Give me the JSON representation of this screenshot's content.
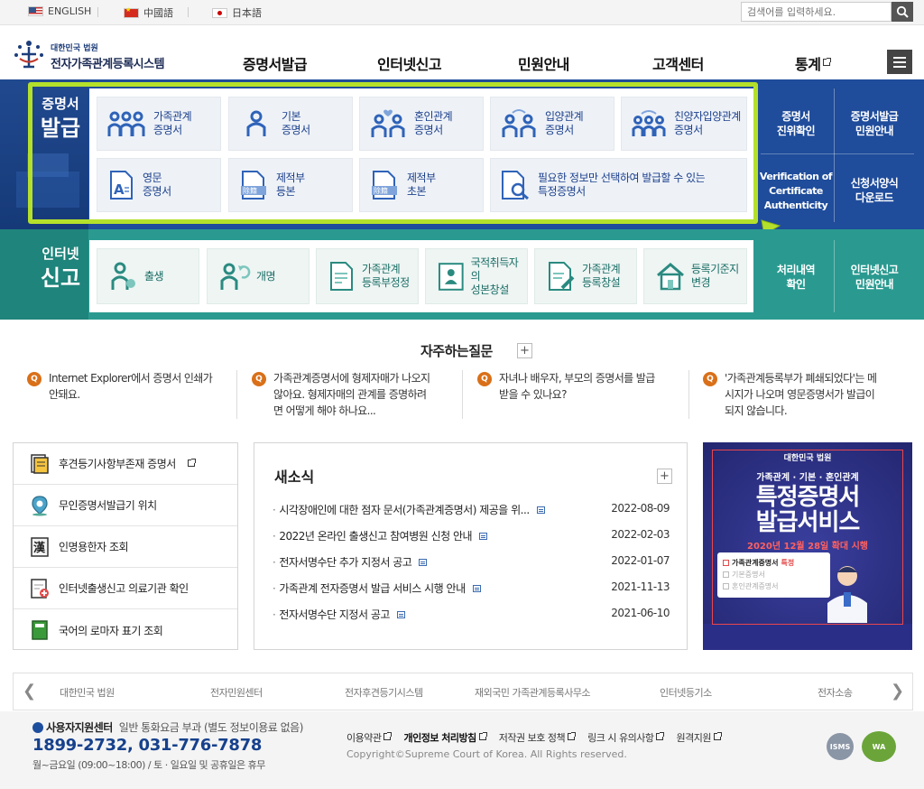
{
  "topbar": {
    "languages": [
      {
        "label": "ENGLISH"
      },
      {
        "label": "中國語"
      },
      {
        "label": "日本語"
      }
    ],
    "search_placeholder": "검색어를 입력하세요."
  },
  "header": {
    "logo_small": "대한민국 법원",
    "logo_big": "전자가족관계등록시스템",
    "nav": [
      "증명서발급",
      "인터넷신고",
      "민원안내",
      "고객센터",
      "통계"
    ]
  },
  "cert_section": {
    "title_small": "증명서",
    "title_big": "발급",
    "cards_row1": [
      {
        "line1": "가족관계",
        "line2": "증명서"
      },
      {
        "line1": "기본",
        "line2": "증명서"
      },
      {
        "line1": "혼인관계",
        "line2": "증명서"
      },
      {
        "line1": "입양관계",
        "line2": "증명서"
      },
      {
        "line1": "친양자입양관계",
        "line2": "증명서"
      }
    ],
    "cards_row2": [
      {
        "line1": "영문",
        "line2": "증명서"
      },
      {
        "line1": "제적부",
        "line2": "등본"
      },
      {
        "line1": "제적부",
        "line2": "초본"
      },
      {
        "line1": "필요한 정보만 선택하여 발급할 수 있는",
        "line2": "특정증명서"
      }
    ],
    "side": {
      "verify_kr": [
        "증명서",
        "진위확인"
      ],
      "guide": [
        "증명서발급",
        "민원안내"
      ],
      "verify_en": [
        "Verification of",
        "Certificate",
        "Authenticity"
      ],
      "form_download": [
        "신청서양식",
        "다운로드"
      ]
    }
  },
  "report_section": {
    "title_small": "인터넷",
    "title_big": "신고",
    "cards": [
      {
        "line1": "출생",
        "line2": ""
      },
      {
        "line1": "개명",
        "line2": ""
      },
      {
        "line1": "가족관계",
        "line2": "등록부정정"
      },
      {
        "line1": "국적취득자의",
        "line2": "성본창설"
      },
      {
        "line1": "가족관계",
        "line2": "등록창설"
      },
      {
        "line1": "등록기준지",
        "line2": "변경"
      }
    ],
    "side": {
      "history": [
        "처리내역",
        "확인"
      ],
      "guide": [
        "인터넷신고",
        "민원안내"
      ]
    }
  },
  "faq": {
    "title": "자주하는질문",
    "badge": "Q",
    "items": [
      {
        "lines": [
          "Internet Explorer에서 증명서 인쇄가",
          "안돼요."
        ]
      },
      {
        "lines": [
          "가족관계증명서에 형제자매가 나오지",
          "않아요. 형제자매의 관계를 증명하려",
          "면 어떻게 해야 하나요..."
        ]
      },
      {
        "lines": [
          "자녀나 배우자, 부모의 증명서를 발급",
          "받을 수 있나요?"
        ]
      },
      {
        "lines": [
          "'가족관계등록부가 폐쇄되었다'는 메",
          "시지가 나오며 영문증명서가 발급이",
          "되지 않습니다."
        ]
      }
    ]
  },
  "quick_links": [
    {
      "label": "후견등기사항부존재 증명서"
    },
    {
      "label": "무인증명서발급기 위치"
    },
    {
      "label": "인명용한자 조회"
    },
    {
      "label": "인터넷출생신고 의료기관 확인"
    },
    {
      "label": "국어의 로마자 표기 조회"
    }
  ],
  "news": {
    "title": "새소식",
    "items": [
      {
        "title": "시각장애인에 대한 점자 문서(가족관계증명서) 제공을 위...",
        "date": "2022-08-09"
      },
      {
        "title": "2022년 온라인 출생신고 참여병원 신청 안내",
        "date": "2022-02-03"
      },
      {
        "title": "전자서명수단 추가 지정서 공고",
        "date": "2022-01-07"
      },
      {
        "title": "가족관계 전자증명서 발급 서비스 시행 안내",
        "date": "2021-11-13"
      },
      {
        "title": "전자서명수단 지정서 공고",
        "date": "2021-06-10"
      }
    ]
  },
  "banner": {
    "org": "대한민국 법원",
    "subtitle": "가족관계 · 기본 · 혼인관계",
    "title1": "특정증명서",
    "title2": "발급서비스",
    "date": "2020년 12월 28일 확대 시행",
    "box": [
      "가족관계증명서",
      "기본증명서",
      "혼인관계증명서"
    ],
    "tag": "특정"
  },
  "related_sites": [
    "대한민국 법원",
    "전자민원센터",
    "전자후견등기시스템",
    "재외국민 가족관계등록사무소",
    "인터넷등기소",
    "전자소송"
  ],
  "footer": {
    "center_label": "사용자지원센터",
    "center_note": "일반 통화요금 부과 (별도 정보이용료 없음)",
    "phone": "1899-2732, 031-776-7878",
    "hours": "월~금요일 (09:00~18:00) / 토 · 일요일 및 공휴일은 휴무",
    "links": [
      "이용약관",
      "개인정보 처리방침",
      "저작권 보호 정책",
      "링크 시 유의사항",
      "원격지원"
    ],
    "copyright": "Copyright©Supreme Court of Korea. All Rights reserved.",
    "cert1": "ISMS",
    "cert2": "WA"
  },
  "colors": {
    "cert_blue": "#1f4c9b",
    "report_teal": "#2a9a90",
    "highlight": "#b4e02b",
    "faq_badge": "#d97019",
    "banner": "#2b2e87"
  }
}
